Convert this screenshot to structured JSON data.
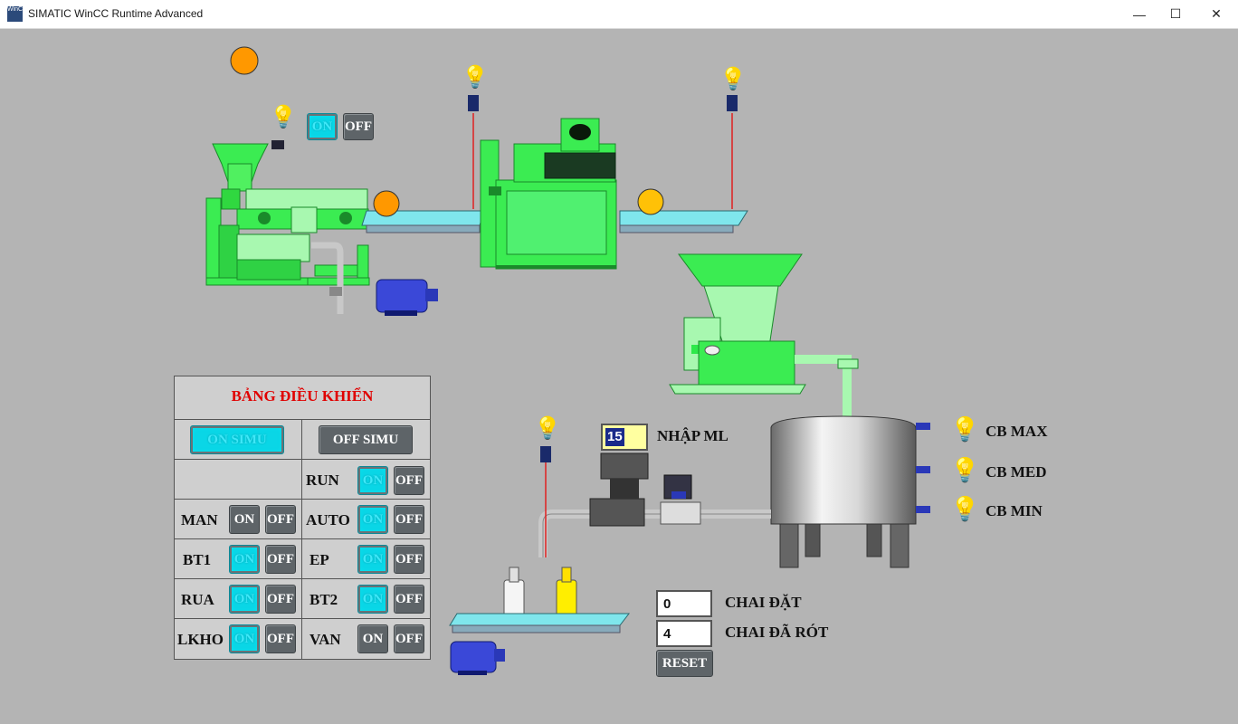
{
  "window": {
    "title": "SIMATIC WinCC Runtime Advanced",
    "icon_text": "WinCC",
    "minimize": "—",
    "maximize": "☐",
    "close": "✕"
  },
  "colors": {
    "background": "#b4b4b4",
    "machine_green": "#2ee84a",
    "conveyor": "#7fe6ec",
    "button_on": "#0ad6e6",
    "panel_title": "#e00000",
    "status_orange": "#ff9800",
    "status_yellow": "#ffc107"
  },
  "top_controls": {
    "on": "ON",
    "off": "OFF"
  },
  "panel": {
    "title": "BẢNG ĐIỀU KHIỂN",
    "on_simu": "ON SIMU",
    "off_simu": "OFF SIMU",
    "rows": [
      {
        "left_label": "",
        "right_label": "RUN"
      },
      {
        "left_label": "MAN",
        "right_label": "AUTO"
      },
      {
        "left_label": "BT1",
        "right_label": "EP"
      },
      {
        "left_label": "RUA",
        "right_label": "BT2"
      },
      {
        "left_label": "LKHO",
        "right_label": "VAN"
      }
    ],
    "on": "ON",
    "off": "OFF"
  },
  "filling": {
    "ml_value": "15",
    "ml_label": "NHẬP ML",
    "set_value": "0",
    "set_label": "CHAI ĐẶT",
    "filled_value": "4",
    "filled_label": "CHAI ĐÃ RÓT",
    "reset": "RESET"
  },
  "tank_sensors": {
    "max": "CB MAX",
    "med": "CB MED",
    "min": "CB MIN"
  }
}
